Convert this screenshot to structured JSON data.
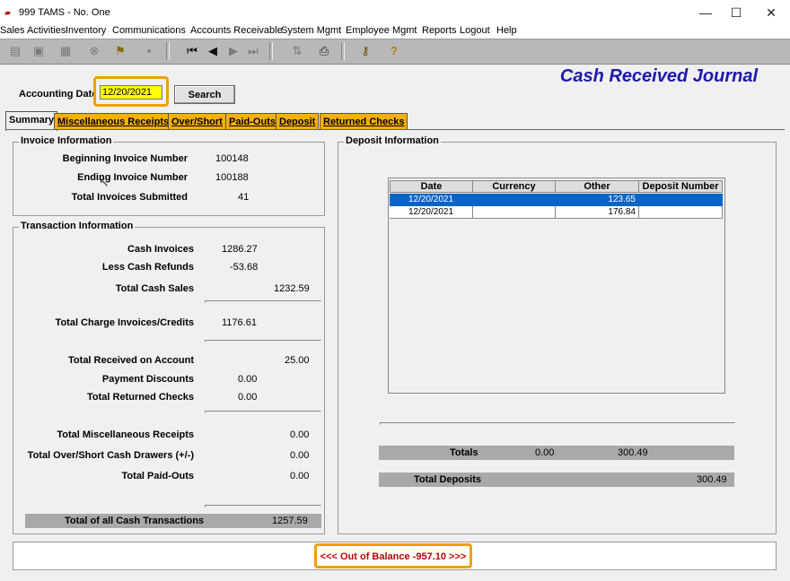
{
  "window": {
    "title": "999 TAMS - No. One",
    "controls": {
      "minimize": "—",
      "maximize": "☐",
      "close": "✕"
    }
  },
  "menu": [
    "Sales Activities",
    "Inventory",
    "Communications",
    "Accounts Receivable",
    "System Mgmt",
    "Employee Mgmt",
    "Reports",
    "Logout",
    "Help"
  ],
  "toolbar": {
    "icons": [
      "new-doc-icon",
      "copy-icon",
      "save-icon",
      "cancel-icon",
      "flag-icon",
      "delete-icon",
      "first-record-icon",
      "prev-record-icon",
      "next-record-icon",
      "last-record-icon",
      "sort-icon",
      "print-icon",
      "key-icon",
      "help-icon"
    ]
  },
  "header": {
    "journal_title": "Cash Received Journal",
    "accounting_date_label": "Accounting Date",
    "accounting_date_value": "12/20/2021",
    "search_label": "Search"
  },
  "tabs": [
    "Summary",
    "Miscellaneous Receipts",
    "Over/Short",
    "Paid-Outs",
    "Deposit",
    "Returned Checks"
  ],
  "invoice_info": {
    "title": "Invoice Information",
    "beginning_label": "Beginning Invoice Number",
    "beginning_value": "100148",
    "ending_label": "Ending Invoice Number",
    "ending_value": "100188",
    "total_label": "Total Invoices Submitted",
    "total_value": "41"
  },
  "transaction_info": {
    "title": "Transaction Information",
    "cash_invoices_label": "Cash Invoices",
    "cash_invoices_value": "1286.27",
    "less_refunds_label": "Less Cash Refunds",
    "less_refunds_value": "-53.68",
    "total_cash_sales_label": "Total Cash Sales",
    "total_cash_sales_value": "1232.59",
    "charge_label": "Total Charge Invoices/Credits",
    "charge_value": "1176.61",
    "received_on_account_label": "Total Received on Account",
    "received_on_account_value": "25.00",
    "payment_discounts_label": "Payment Discounts",
    "payment_discounts_value": "0.00",
    "returned_checks_label": "Total Returned Checks",
    "returned_checks_value": "0.00",
    "misc_receipts_label": "Total Miscellaneous Receipts",
    "misc_receipts_value": "0.00",
    "over_short_label": "Total Over/Short Cash Drawers (+/-)",
    "over_short_value": "0.00",
    "paid_outs_label": "Total Paid-Outs",
    "paid_outs_value": "0.00",
    "total_all_label": "Total of all Cash Transactions",
    "total_all_value": "1257.59"
  },
  "deposit_info": {
    "title": "Deposit Information",
    "columns": [
      "Date",
      "Currency",
      "Other",
      "Deposit Number"
    ],
    "rows": [
      {
        "date": "12/20/2021",
        "currency": "",
        "other": "123.65",
        "deposit_number": ""
      },
      {
        "date": "12/20/2021",
        "currency": "",
        "other": "176.84",
        "deposit_number": ""
      }
    ],
    "totals_label": "Totals",
    "totals_currency": "0.00",
    "totals_other": "300.49",
    "total_deposits_label": "Total Deposits",
    "total_deposits_value": "300.49"
  },
  "status": {
    "balance_text": "<<< Out of Balance -957.10 >>>"
  },
  "colors": {
    "accent_title": "#1a1ab0",
    "tab_bg": "#f5b000",
    "highlight_border": "#f0a000",
    "selected_row": "#0a64c8",
    "error_text": "#c00000"
  }
}
